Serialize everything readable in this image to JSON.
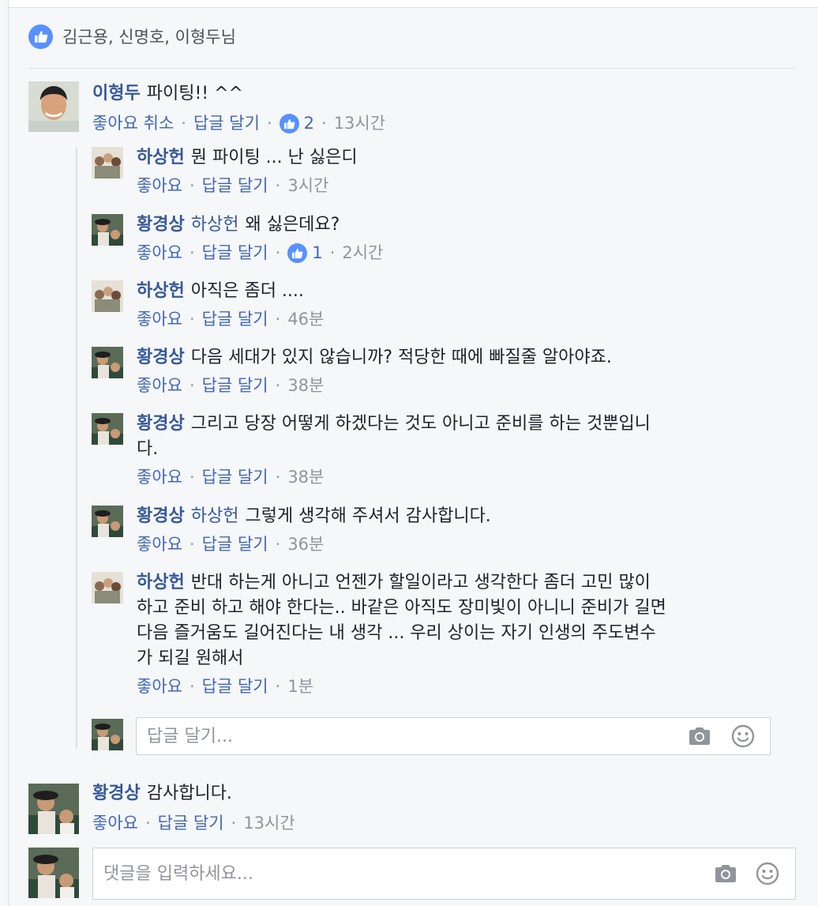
{
  "likes": {
    "names": "김근용, 신명호, 이형두님"
  },
  "top_comments": [
    {
      "author": "이형두",
      "text": "파이팅!! ^^",
      "actions": {
        "like": "좋아요 취소",
        "reply": "답글 달기",
        "reaction_count": "2",
        "time": "13시간"
      }
    },
    {
      "author": "황경상",
      "text": "감사합니다.",
      "actions": {
        "like": "좋아요",
        "reply": "답글 달기",
        "time": "13시간"
      }
    }
  ],
  "replies": [
    {
      "author": "하상헌",
      "mention": "",
      "text": "뭔 파이팅 ... 난 싫은디",
      "like": "좋아요",
      "reply": "답글 달기",
      "reaction_count": "",
      "time": "3시간"
    },
    {
      "author": "황경상",
      "mention": "하상헌",
      "text": "왜 싫은데요?",
      "like": "좋아요",
      "reply": "답글 달기",
      "reaction_count": "1",
      "time": "2시간"
    },
    {
      "author": "하상헌",
      "mention": "",
      "text": "아직은 좀더 ....",
      "like": "좋아요",
      "reply": "답글 달기",
      "reaction_count": "",
      "time": "46분"
    },
    {
      "author": "황경상",
      "mention": "",
      "text": "다음 세대가 있지 않습니까? 적당한 때에 빠질줄 알아야죠.",
      "like": "좋아요",
      "reply": "답글 달기",
      "reaction_count": "",
      "time": "38분"
    },
    {
      "author": "황경상",
      "mention": "",
      "text": "그리고 당장 어떻게 하겠다는 것도 아니고 준비를 하는 것뿐입니\n다.",
      "like": "좋아요",
      "reply": "답글 달기",
      "reaction_count": "",
      "time": "38분"
    },
    {
      "author": "황경상",
      "mention": "하상헌",
      "text": "그렇게 생각해 주셔서 감사합니다.",
      "like": "좋아요",
      "reply": "답글 달기",
      "reaction_count": "",
      "time": "36분"
    },
    {
      "author": "하상헌",
      "mention": "",
      "text": "반대 하는게 아니고 언젠가 할일이라고 생각한다 좀더 고민 많이\n하고 준비 하고 해야 한다는.. 바같은 아직도 장미빛이 아니니 준비가 길면\n다음 즐거움도 길어진다는 내 생각 ... 우리 상이는 자기 인생의 주도변수\n가 되길 원해서",
      "like": "좋아요",
      "reply": "답글 달기",
      "reaction_count": "",
      "time": "1분"
    }
  ],
  "reply_input": {
    "placeholder": "답글 달기..."
  },
  "comment_input": {
    "placeholder": "댓글을 입력하세요..."
  },
  "icons": {
    "like": "thumbs-up-icon",
    "camera": "camera-icon",
    "emoji": "smiley-icon"
  },
  "colors": {
    "link": "#365899",
    "action": "#4267b2",
    "meta": "#90949c",
    "like_badge": "#5890ff"
  }
}
